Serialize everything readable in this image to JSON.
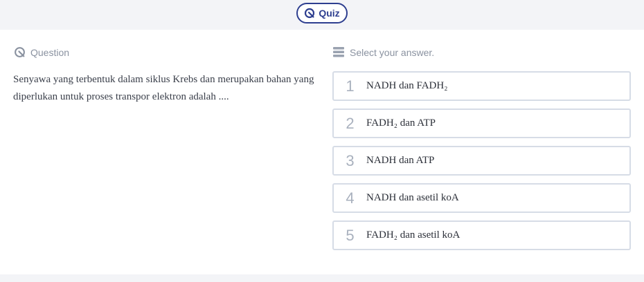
{
  "quiz_pill": {
    "label": "Quiz",
    "icon": "quiz-icon",
    "color": "#2d3e8f"
  },
  "question": {
    "header_label": "Question",
    "header_icon": "quiz-icon",
    "text": "Senyawa yang terbentuk dalam siklus Krebs dan merupakan bahan yang diperlukan untuk proses transpor elektron adalah ...."
  },
  "answers": {
    "header_label": "Select your answer.",
    "header_icon": "list-icon",
    "options": [
      {
        "number": "1",
        "label": "NADH dan FADH₂"
      },
      {
        "number": "2",
        "label": "FADH₂ dan ATP"
      },
      {
        "number": "3",
        "label": "NADH dan ATP"
      },
      {
        "number": "4",
        "label": "NADH dan asetil koA"
      },
      {
        "number": "5",
        "label": "FADH₂ dan asetil koA"
      }
    ]
  },
  "colors": {
    "accent": "#2d3e8f",
    "muted": "#8a92a0",
    "option_border": "#d6dce6",
    "background": "#f3f4f7"
  }
}
